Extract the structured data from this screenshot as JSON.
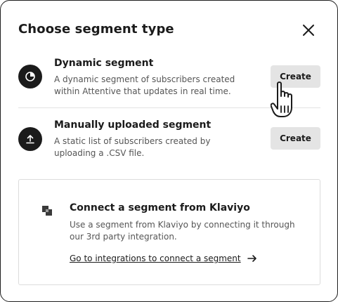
{
  "dialog": {
    "title": "Choose segment type",
    "close_icon": "close-icon"
  },
  "segments": [
    {
      "icon": "pie-chart-icon",
      "title": "Dynamic segment",
      "description": "A dynamic segment of subscribers created within Attentive that updates in real time.",
      "button_label": "Create"
    },
    {
      "icon": "upload-icon",
      "title": "Manually uploaded segment",
      "description": "A static list of subscribers created by uploading a .CSV file.",
      "button_label": "Create"
    }
  ],
  "klaviyo": {
    "icon": "klaviyo-logo-icon",
    "title": "Connect a segment from Klaviyo",
    "description": "Use a segment from Klaviyo by connecting it through our 3rd party integration.",
    "link_label": "Go to integrations to connect a segment",
    "link_icon": "arrow-right-icon"
  },
  "cursor": "hand-pointer-icon",
  "colors": {
    "text": "#1b1b1b",
    "muted_text": "#555555",
    "button_bg": "#e4e4e4",
    "icon_bg": "#1b1b1b",
    "divider": "#e2e2e2"
  }
}
